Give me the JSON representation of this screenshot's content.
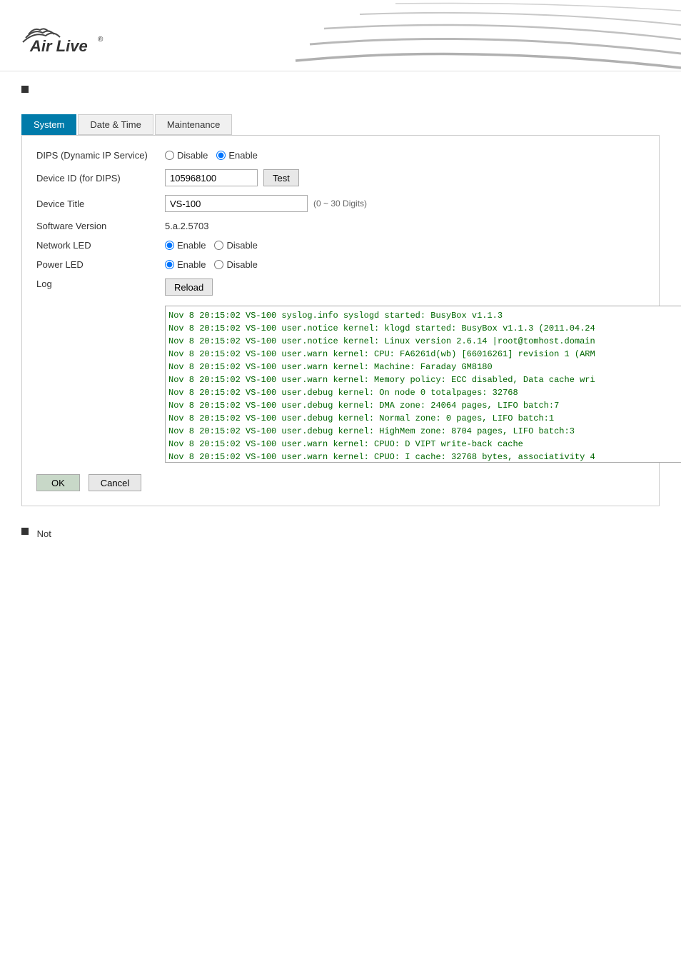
{
  "header": {
    "brand": "Air Live",
    "registered": "®"
  },
  "tabs": [
    {
      "id": "system",
      "label": "System",
      "active": true
    },
    {
      "id": "datetime",
      "label": "Date & Time",
      "active": false
    },
    {
      "id": "maintenance",
      "label": "Maintenance",
      "active": false
    }
  ],
  "form": {
    "dips_label": "DIPS (Dynamic IP Service)",
    "dips_disable": "Disable",
    "dips_enable": "Enable",
    "dips_selected": "enable",
    "device_id_label": "Device ID (for DIPS)",
    "device_id_value": "105968100",
    "device_id_test_btn": "Test",
    "device_title_label": "Device Title",
    "device_title_value": "VS-100",
    "device_title_hint": "(0 ~ 30 Digits)",
    "software_version_label": "Software Version",
    "software_version_value": "5.a.2.5703",
    "network_led_label": "Network LED",
    "network_led_enable": "Enable",
    "network_led_disable": "Disable",
    "network_led_selected": "enable",
    "power_led_label": "Power LED",
    "power_led_enable": "Enable",
    "power_led_disable": "Disable",
    "power_led_selected": "enable",
    "log_label": "Log",
    "log_reload_btn": "Reload",
    "log_lines": [
      "Nov  8 20:15:02 VS-100 syslog.info syslogd started: BusyBox v1.1.3",
      "Nov  8 20:15:02 VS-100 user.notice kernel: klogd started: BusyBox v1.1.3 (2011.04.24",
      "Nov  8 20:15:02 VS-100 user.notice kernel: Linux version 2.6.14 |root@tomhost.domain",
      "Nov  8 20:15:02 VS-100 user.warn kernel: CPU: FA6261d(wb) [66016261] revision 1 (ARM",
      "Nov  8 20:15:02 VS-100 user.warn kernel: Machine: Faraday GM8180",
      "Nov  8 20:15:02 VS-100 user.warn kernel: Memory policy: ECC disabled, Data cache wri",
      "Nov  8 20:15:02 VS-100 user.debug kernel: On node 0 totalpages: 32768",
      "Nov  8 20:15:02 VS-100 user.debug kernel:   DMA zone: 24064 pages, LIFO batch:7",
      "Nov  8 20:15:02 VS-100 user.debug kernel:   Normal zone: 0 pages, LIFO batch:1",
      "Nov  8 20:15:02 VS-100 user.debug kernel:   HighMem zone: 8704 pages, LIFO batch:3",
      "Nov  8 20:15:02 VS-100 user.warn kernel: CPUO: D VIPT write-back cache",
      "Nov  8 20:15:02 VS-100 user.warn kernel: CPUO: I cache: 32768 bytes, associativity 4"
    ],
    "ok_btn": "OK",
    "cancel_btn": "Cancel"
  },
  "section1_bullet": "■",
  "section2_bullet": "■",
  "not_text": "Not"
}
